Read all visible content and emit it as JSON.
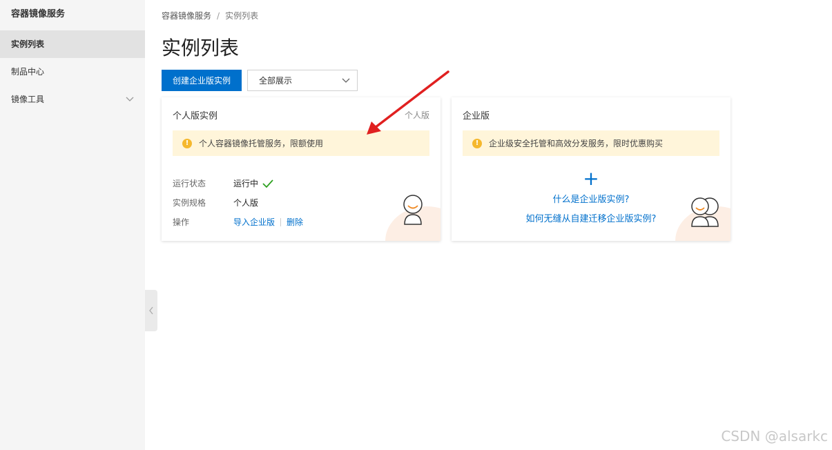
{
  "sidebar": {
    "title": "容器镜像服务",
    "items": [
      {
        "label": "实例列表",
        "active": true
      },
      {
        "label": "制品中心",
        "active": false
      },
      {
        "label": "镜像工具",
        "active": false,
        "expandable": true
      }
    ]
  },
  "breadcrumb": {
    "root": "容器镜像服务",
    "separator": "/",
    "current": "实例列表"
  },
  "page": {
    "title": "实例列表"
  },
  "toolbar": {
    "create_label": "创建企业版实例",
    "filter_value": "全部展示"
  },
  "personal_card": {
    "title": "个人版实例",
    "tag": "个人版",
    "notice": "个人容器镜像托管服务，限额使用",
    "rows": {
      "status_label": "运行状态",
      "status_value": "运行中",
      "spec_label": "实例规格",
      "spec_value": "个人版",
      "action_label": "操作",
      "action_import": "导入企业版",
      "action_delete": "删除"
    }
  },
  "enterprise_card": {
    "title": "企业版",
    "notice": "企业级安全托管和高效分发服务，限时优惠购买",
    "plus": "+",
    "link_what": "什么是企业版实例?",
    "link_migrate": "如何无缝从自建迁移企业版实例?"
  },
  "watermark": "CSDN @alsarkc",
  "colors": {
    "primary": "#0070cc",
    "notice_bg": "#fff5da",
    "warn": "#f5b82e",
    "success": "#2ea121",
    "annotation_arrow": "#e02020"
  }
}
